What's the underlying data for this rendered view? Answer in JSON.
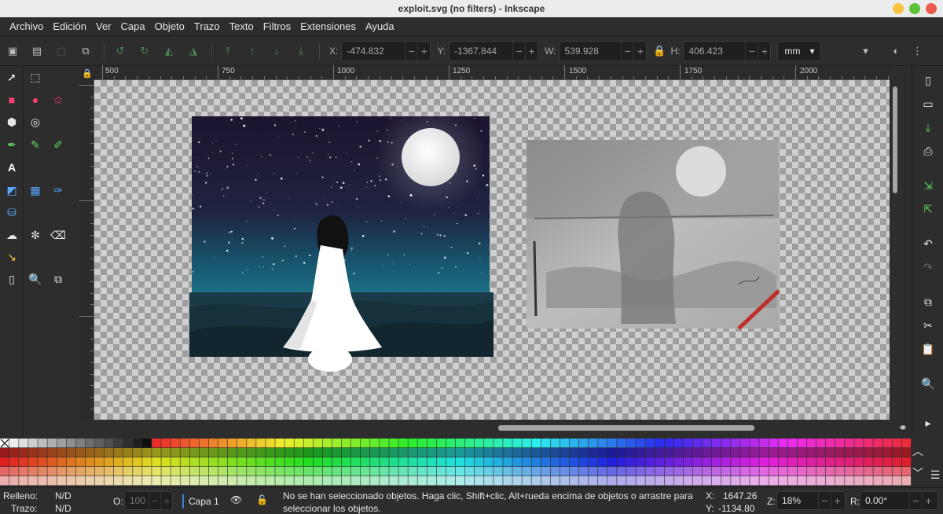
{
  "window": {
    "title": "exploit.svg (no filters) - Inkscape"
  },
  "menu": [
    "Archivo",
    "Edición",
    "Ver",
    "Capa",
    "Objeto",
    "Trazo",
    "Texto",
    "Filtros",
    "Extensiones",
    "Ayuda"
  ],
  "controls": {
    "x_label": "X:",
    "x_value": "-474.832",
    "y_label": "Y:",
    "y_value": "-1367.844",
    "w_label": "W:",
    "w_value": "539.928",
    "h_label": "H:",
    "h_value": "406.423",
    "unit": "mm"
  },
  "ruler": {
    "ticks": [
      "500",
      "750",
      "1000",
      "1250",
      "1500",
      "1750",
      "2000"
    ]
  },
  "status": {
    "fill_label": "Relleno:",
    "fill_value": "N/D",
    "stroke_label": "Trazo:",
    "stroke_value": "N/D",
    "opacity_label": "O:",
    "opacity_value": "100",
    "layer": "Capa 1",
    "message": "No se han seleccionado objetos. Haga clic, Shift+clic, Alt+rueda encima de objetos o arrastre para seleccionar los objetos.",
    "cursor_x_label": "X:",
    "cursor_x": "1647.26",
    "cursor_y_label": "Y:",
    "cursor_y": "-1134.80",
    "zoom_label": "Z:",
    "zoom": "18%",
    "rotation_label": "R:",
    "rotation": "0.00°"
  },
  "colors": {
    "accent": "#e63b3b",
    "ui_bg": "#2d2d2d",
    "night_sky": "#1e1530",
    "sea": "#1b6f84"
  }
}
